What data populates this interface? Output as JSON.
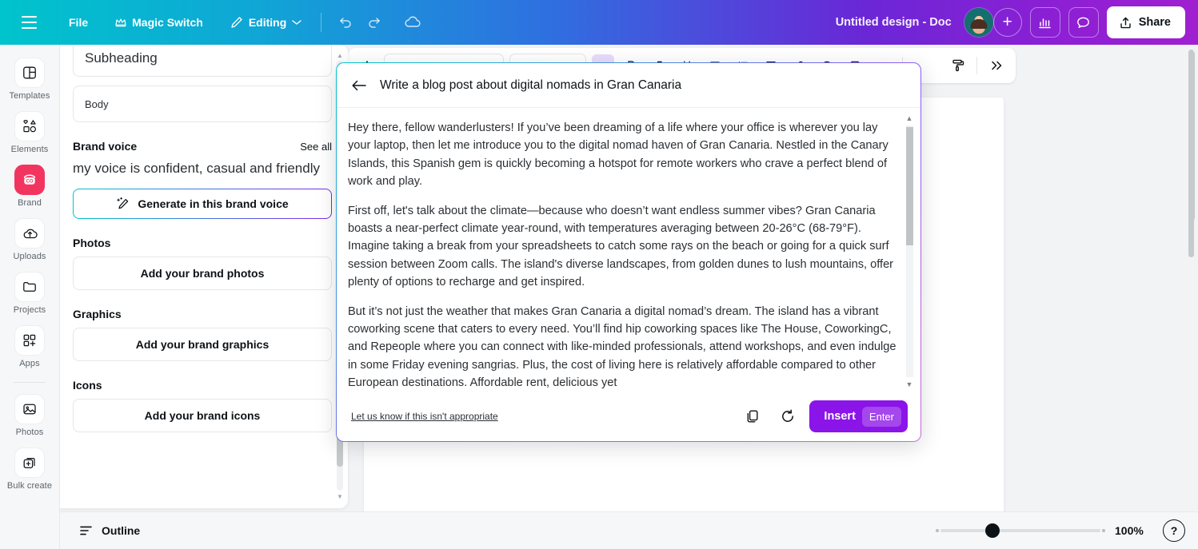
{
  "topbar": {
    "menu_icon": "hamburger-icon",
    "file_label": "File",
    "magic_switch_label": "Magic Switch",
    "magic_switch_icon": "crown-icon",
    "editing_label": "Editing",
    "editing_icon": "pencil-icon",
    "editing_caret": "chevron-down-icon",
    "undo_icon": "undo-icon",
    "redo_icon": "redo-icon",
    "cloud_icon": "cloud-saved-icon",
    "doc_title": "Untitled design - Doc",
    "add_collaborator_label": "+",
    "insights_icon": "bar-chart-icon",
    "comments_icon": "comment-icon",
    "share_label": "Share",
    "share_icon": "upload-icon",
    "gradient_start": "#00c4cc",
    "gradient_end": "#a020d0"
  },
  "rail": {
    "items": [
      {
        "label": "Templates",
        "icon": "templates-icon",
        "active": false
      },
      {
        "label": "Elements",
        "icon": "elements-icon",
        "active": false
      },
      {
        "label": "Brand",
        "icon": "brand-icon",
        "active": true
      },
      {
        "label": "Uploads",
        "icon": "uploads-cloud-icon",
        "active": false
      },
      {
        "label": "Projects",
        "icon": "folder-icon",
        "active": false
      },
      {
        "label": "Apps",
        "icon": "apps-grid-plus-icon",
        "active": false
      },
      {
        "label": "Photos",
        "icon": "photo-icon",
        "active": false
      },
      {
        "label": "Bulk create",
        "icon": "bulk-create-icon",
        "active": false
      }
    ],
    "brand_accent": "#f2355f"
  },
  "panel": {
    "subheading_field": "Subheading",
    "body_field": "Body",
    "brand_voice_title": "Brand voice",
    "see_all_label": "See all",
    "voice_text": "my voice is confident, casual and friendly",
    "generate_label": "Generate in this brand voice",
    "generate_icon": "magic-pen-icon",
    "photos_title": "Photos",
    "add_photos_label": "Add your brand photos",
    "graphics_title": "Graphics",
    "add_graphics_label": "Add your brand graphics",
    "icons_title": "Icons",
    "add_icons_label": "Add your brand icons"
  },
  "dialog": {
    "back_icon": "back-arrow-icon",
    "title": "Write a blog post about digital nomads in Gran Canaria",
    "paragraphs": [
      "Hey there, fellow wanderlusters! If you’ve been dreaming of a life where your office is wherever you lay your laptop, then let me introduce you to the digital nomad haven of Gran Canaria. Nestled in the Canary Islands, this Spanish gem is quickly becoming a hotspot for remote workers who crave a perfect blend of work and play.",
      "First off, let's talk about the climate—because who doesn’t want endless summer vibes? Gran Canaria boasts a near-perfect climate year-round, with temperatures averaging between 20-26°C (68-79°F). Imagine taking a break from your spreadsheets to catch some rays on the beach or going for a quick surf session between Zoom calls. The island's diverse landscapes, from golden dunes to lush mountains, offer plenty of options to recharge and get inspired.",
      "But it’s not just the weather that makes Gran Canaria a digital nomad’s dream. The island has a vibrant coworking scene that caters to every need. You’ll find hip coworking spaces like The House, CoworkingC, and Repeople where you can connect with like-minded professionals, attend workshops, and even indulge in some Friday evening sangrias. Plus, the cost of living here is relatively affordable compared to other European destinations. Affordable rent, delicious yet"
    ],
    "report_link": "Let us know if this isn't appropriate",
    "copy_icon": "copy-icon",
    "regenerate_icon": "regenerate-icon",
    "insert_label": "Insert",
    "insert_shortcut": "Enter",
    "insert_color": "#8b14e8"
  },
  "toolbar": {
    "paint_icon": "paint-roller-icon",
    "expand_icon": "double-chevron-right-icon"
  },
  "bottombar": {
    "outline_label": "Outline",
    "outline_icon": "outline-icon",
    "zoom_level": "100%",
    "help_label": "?"
  }
}
